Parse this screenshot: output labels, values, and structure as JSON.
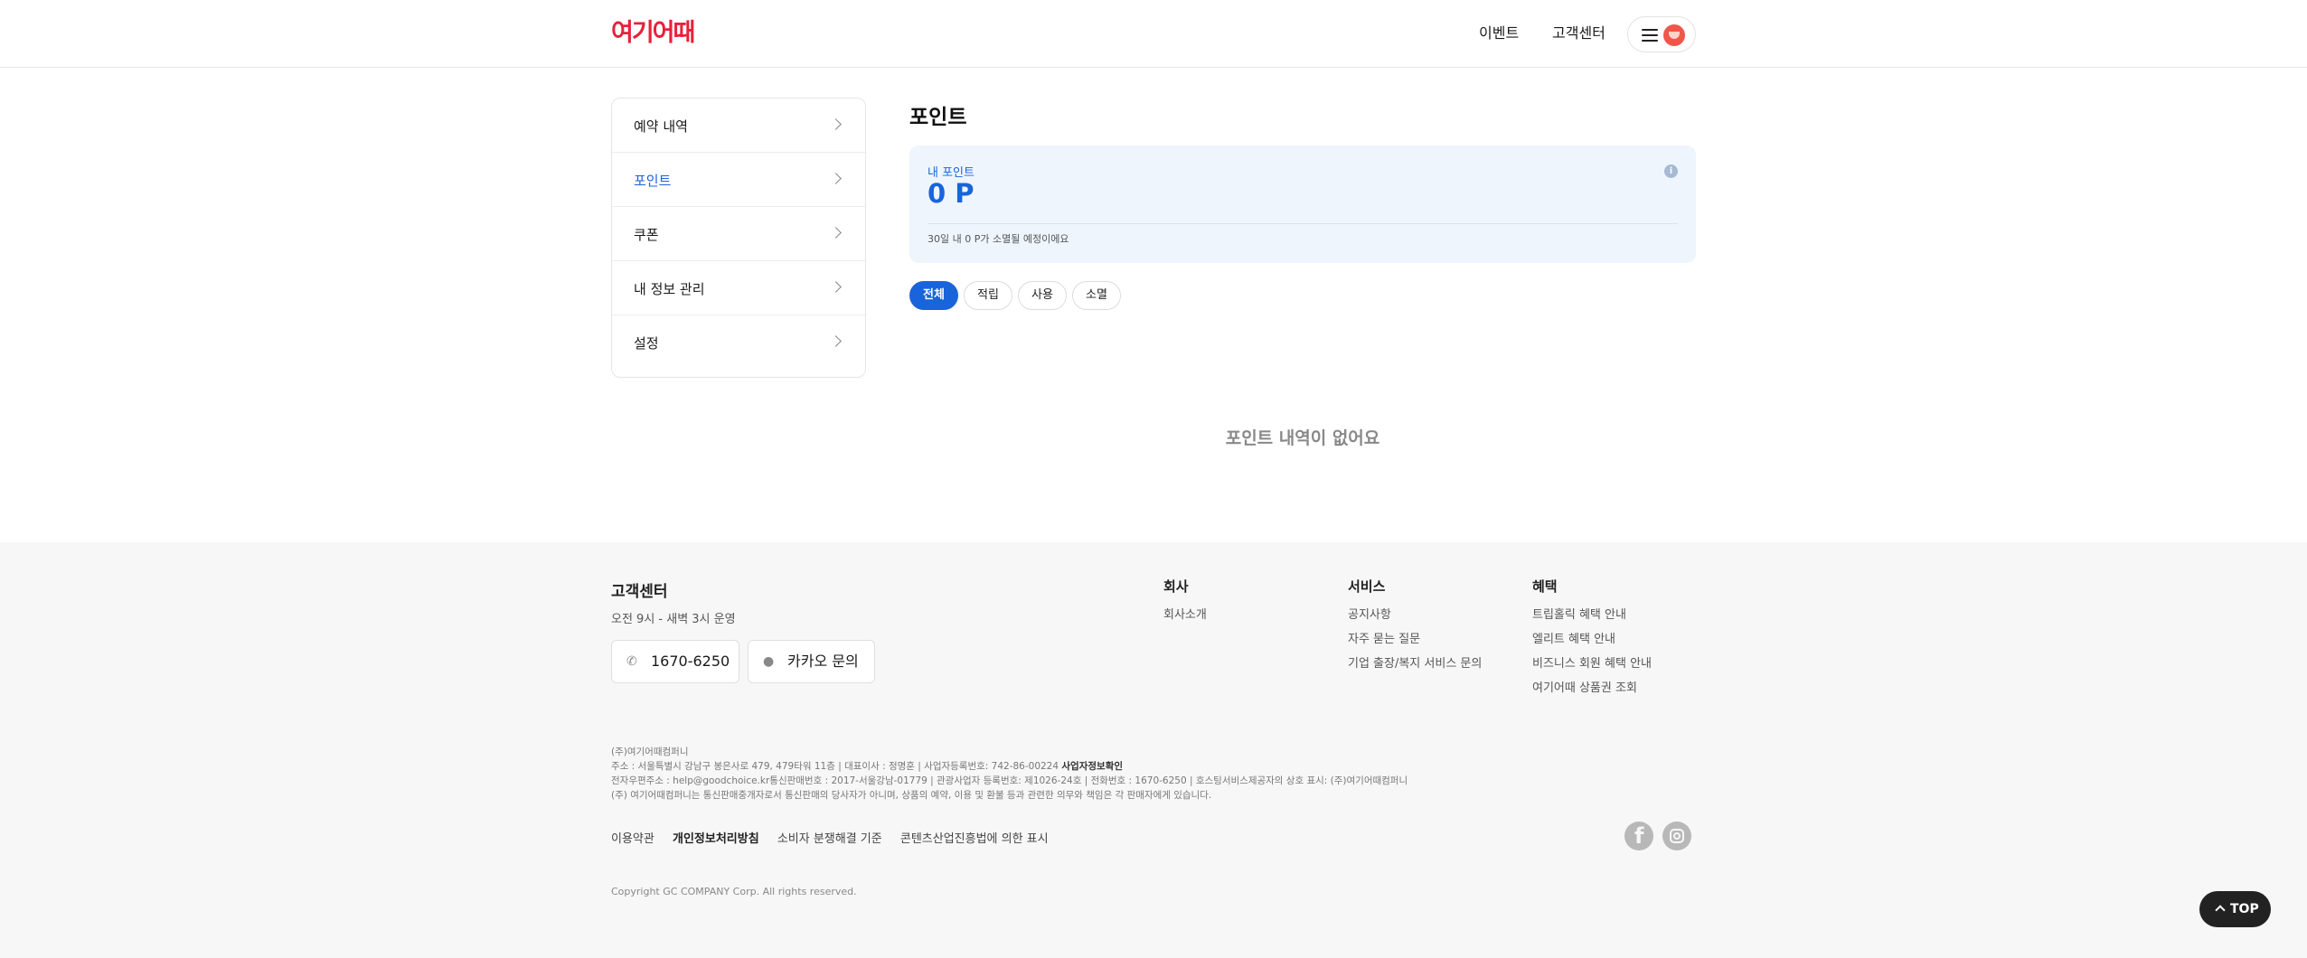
{
  "header": {
    "logo_text": "여기어때",
    "nav": [
      "이벤트",
      "고객센터"
    ]
  },
  "sidebar": {
    "items": [
      {
        "label": "예약 내역"
      },
      {
        "label": "포인트",
        "active": true
      },
      {
        "label": "쿠폰"
      },
      {
        "label": "내 정보 관리"
      },
      {
        "label": "설정"
      }
    ]
  },
  "main": {
    "title": "포인트",
    "card": {
      "label": "내 포인트",
      "value": "0 P",
      "note": "30일 내 0 P가 소멸될 예정이에요"
    },
    "filters": [
      "전체",
      "적립",
      "사용",
      "소멸"
    ],
    "active_filter": "전체",
    "empty_message": "포인트 내역이 없어요"
  },
  "footer": {
    "cs_title": "고객센터",
    "cs_hours": "오전 9시 - 새벽 3시 운영",
    "phone_label": "1670-6250",
    "kakao_label": "카카오 문의",
    "columns": [
      {
        "title": "회사",
        "items": [
          "회사소개"
        ]
      },
      {
        "title": "서비스",
        "items": [
          "공지사항",
          "자주 묻는 질문",
          "기업 출장/복지 서비스 문의"
        ]
      },
      {
        "title": "혜택",
        "items": [
          "트립홀릭 혜택 안내",
          "엘리트 혜택 안내",
          "비즈니스 회원 혜택 안내",
          "여기어때 상품권 조회"
        ]
      }
    ],
    "legal": {
      "line1": "(주)여기어때컴퍼니",
      "line2": "주소 : 서울특별시 강남구 봉은사로 479, 479타워 11층 | 대표이사 : 정명훈 | 사업자등록번호: 742-86-00224",
      "line2_link": "사업자정보확인",
      "line3": "전자우편주소 : help@goodchoice.kr통신판매번호 : 2017-서울강남-01779 | 관광사업자 등록번호: 제1026-24호 | 전화번호 : 1670-6250 | 호스팅서비스제공자의 상호 표시: (주)여기어때컴퍼니",
      "line4": "(주) 여기어때컴퍼니는 통신판매중개자로서 통신판매의 당사자가 아니며, 상품의 예약, 이용 및 환불 등과 관련한 의무와 책임은 각 판매자에게 있습니다."
    },
    "links": [
      "이용약관",
      "개인정보처리방침",
      "소비자 분쟁해결 기준",
      "콘텐츠산업진흥법에 의한 표시"
    ],
    "copyright": "Copyright GC COMPANY Corp. All rights reserved."
  },
  "top_button": "TOP",
  "colors": {
    "brand": "#e6223a",
    "accent": "#1a64db",
    "card_bg": "#eef5fd",
    "footer_bg": "#f7f7f7"
  }
}
